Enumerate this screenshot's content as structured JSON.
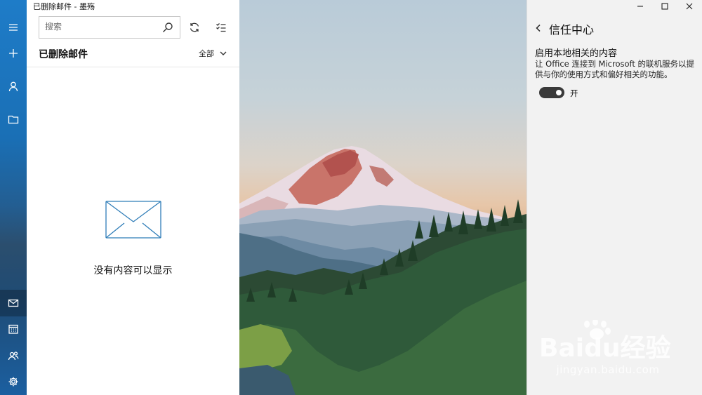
{
  "window": {
    "title": "已删除邮件 - 墨殇"
  },
  "rail": {
    "items": [
      "menu",
      "new-mail",
      "accounts",
      "folders",
      "mail",
      "calendar",
      "people",
      "settings"
    ]
  },
  "mail_pane": {
    "search_placeholder": "搜索",
    "folder_title": "已删除邮件",
    "filter_label": "全部",
    "empty_message": "没有内容可以显示"
  },
  "flyout": {
    "title": "信任中心",
    "section_title": "启用本地相关的内容",
    "section_desc": "让 Office 连接到 Microsoft 的联机服务以提供与你的使用方式和偏好相关的功能。",
    "toggle_state": "开"
  },
  "watermark": {
    "brand": "Baidu经验",
    "url": "jingyan.baidu.com"
  },
  "colors": {
    "accent": "#1e7cc8",
    "toggle_on": "#3a3a3a",
    "flyout_bg": "#f2f2f2"
  }
}
